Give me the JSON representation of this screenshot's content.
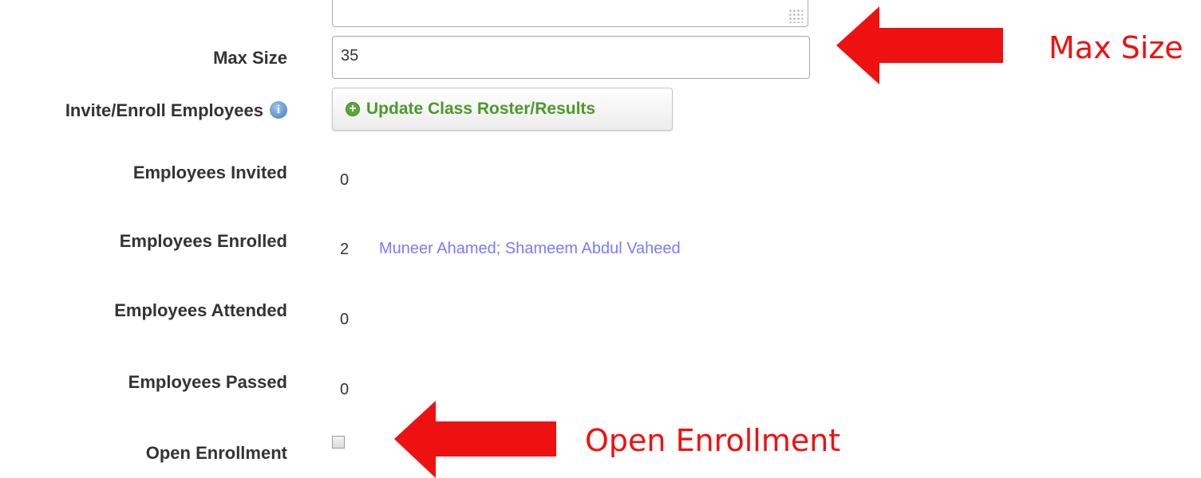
{
  "form": {
    "max_size_label": "Max Size",
    "max_size_value": "35",
    "invite_label": "Invite/Enroll Employees",
    "update_button_label": "Update Class Roster/Results",
    "invited_label": "Employees Invited",
    "invited_value": "0",
    "enrolled_label": "Employees Enrolled",
    "enrolled_value": "2",
    "enrolled_names": [
      "Muneer Ahamed",
      "Shameem Abdul Vaheed"
    ],
    "attended_label": "Employees Attended",
    "attended_value": "0",
    "passed_label": "Employees Passed",
    "passed_value": "0",
    "open_enrollment_label": "Open Enrollment",
    "open_enrollment_checked": false
  },
  "annotations": {
    "max_size_callout": "Max Size",
    "open_enrollment_callout": "Open Enrollment",
    "color": "#ee1111"
  },
  "icons": {
    "info": "info-icon",
    "add": "plus-circle-icon",
    "arrow": "red-left-arrow"
  }
}
